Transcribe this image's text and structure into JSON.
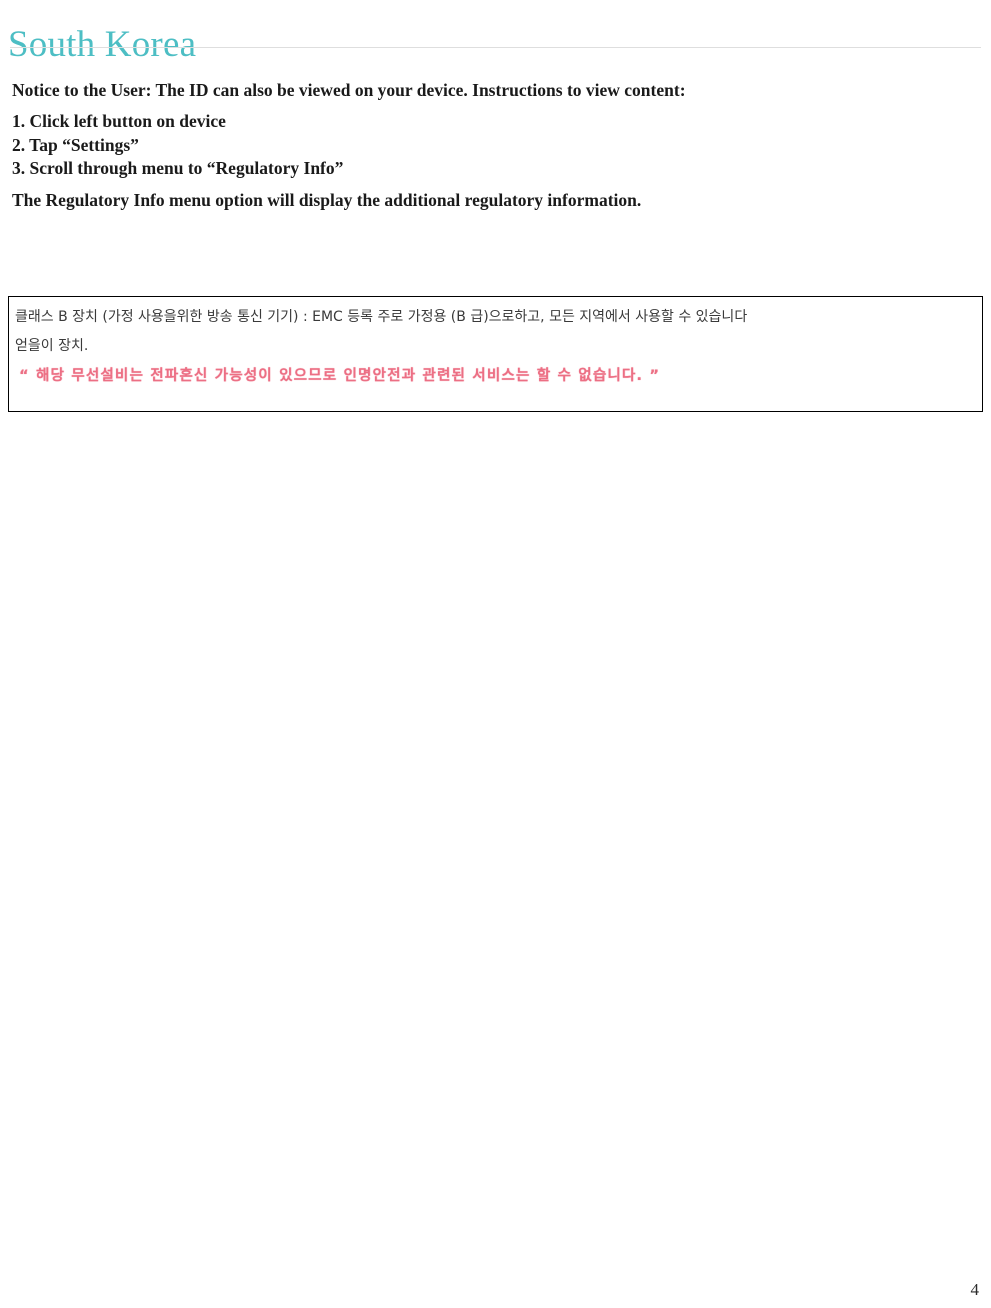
{
  "document": {
    "title": "South Korea",
    "title_color": "#4DBEC4",
    "page_number": "4"
  },
  "notice": {
    "lead": "Notice to the User:  The ID can also be viewed on your device.  Instructions to view content:",
    "steps": [
      "1. Click left button on device",
      "2. Tap “Settings”",
      "3. Scroll through menu to “Regulatory Info”"
    ],
    "tail": "The Regulatory Info menu option will display the additional regulatory information."
  },
  "regulatory_box": {
    "line_1": "클래스 B 장치 (가정 사용을위한 방송 통신 기기) : EMC 등록 주로 가정용 (B 급)으로하고, 모든 지역에서 사용할 수 있습니다",
    "line_2": "얻을이 장치.",
    "line_3": "“ 해당 무선설비는 전파혼신 가능성이 있으므로 인명안전과 관련된 서비스는 할 수 없습니다. ”",
    "line_3_color": "#EC6A80",
    "border_color": "#000000"
  }
}
